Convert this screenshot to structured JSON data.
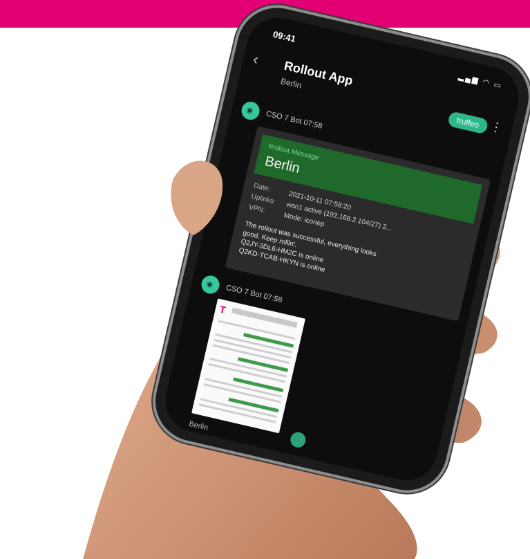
{
  "colors": {
    "brand_magenta": "#e20074",
    "accent_green": "#2fb58b",
    "banner_green": "#1f6a2b"
  },
  "status_bar": {
    "time": "09:41",
    "icons": "signal wifi battery"
  },
  "header": {
    "title": "Rollout App",
    "subtitle": "Berlin",
    "action_label": "trufleo"
  },
  "messages": [
    {
      "sender": "CSO 7 Bot   07:58",
      "banner_label": "Rollout Message",
      "banner_city": "Berlin",
      "fields": [
        {
          "key": "Date:",
          "value": "2021-10-11 07:58:20"
        },
        {
          "key": "Uplinks:",
          "value": "wan1 active (192.168.2.104/27) 2..."
        },
        {
          "key": "VPN:",
          "value": "Mode: iconep"
        }
      ],
      "text_lines": [
        "The rollout was successful, everything looks",
        "good. Keep rollin'.",
        "Q2JY-3DL6-HM2C is online",
        "Q2KD-TCAB-HKYN is online"
      ]
    },
    {
      "sender": "CSO 7 Bot   07:58",
      "caption": "Berlin"
    }
  ]
}
